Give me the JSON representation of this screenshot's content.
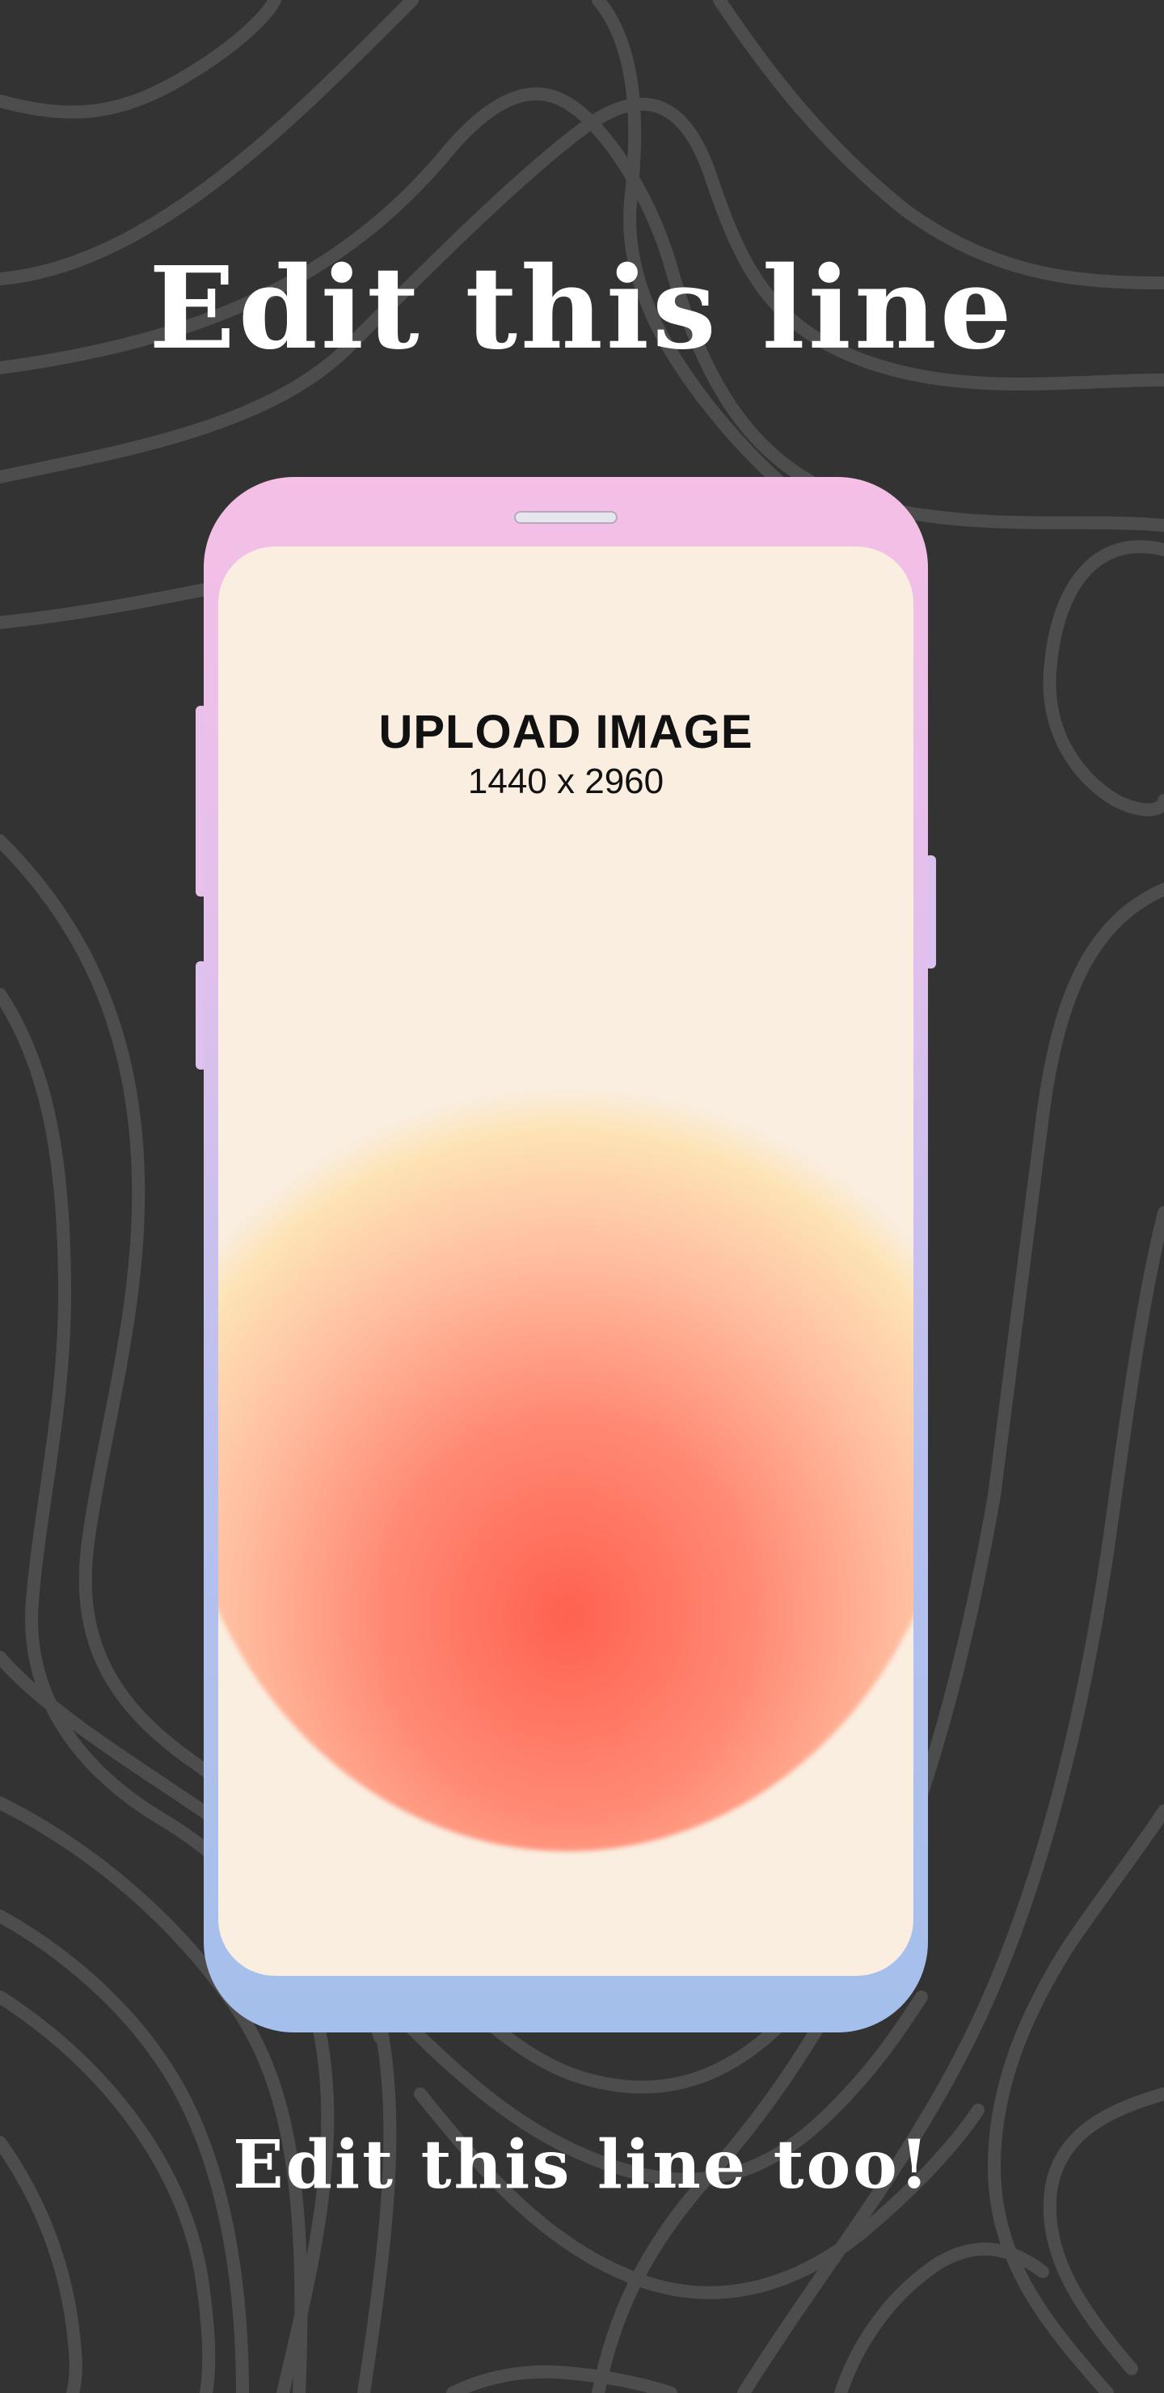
{
  "headline_top": "Edit this line",
  "headline_bottom": "Edit this line too!",
  "screen": {
    "upload_title": "UPLOAD IMAGE",
    "upload_size": "1440 x 2960"
  },
  "colors": {
    "background": "#333333",
    "contour_lines": "#4d4d4d",
    "phone_top": "#f5bfe6",
    "phone_bottom": "#a4bfeb",
    "screen": "#faeee0",
    "blob_core": "#ff6150",
    "blob_edge": "#fde3b5"
  }
}
